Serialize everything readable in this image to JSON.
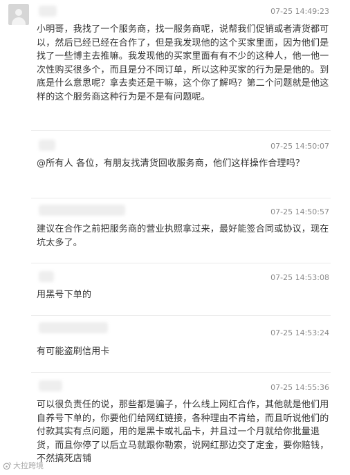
{
  "messages": [
    {
      "time": "07-25 14:49:23",
      "text": "小明哥，我找了一个服务商，找一服务商呢，说帮我们促销或者清货都可以，然后已经已经在合作了，但是我发现他的这个买家里面，因为他们是找了一些博主去推嘛。我发现他的买家里面有有不少的这种人，他一他一次性购买很多个，而且是分不同订单，所以这种买家的行为是是他的。到底是什么意思呢？拿去卖还是干嘛，这个你了解吗？第二个问题就是他这样的这个服务商这种行为是不是有问题呢。"
    },
    {
      "time": "07-25 14:50:07",
      "text": "@所有人 各位，有朋友找清货回收服务商，他们这样操作合理吗？"
    },
    {
      "time": "07-25 14:50:57",
      "text": "建议在合作之前把服务商的营业执照拿过来，最好能签合同或协议，现在坑太多了。"
    },
    {
      "time": "07-25 14:53:08",
      "text": "用黑号下单的"
    },
    {
      "time": "07-25 14:53:24",
      "text": "有可能盗刷信用卡"
    },
    {
      "time": "07-25 14:55:36",
      "text": "可以很负责任的说，那些都是骗子，什么线上网红合作，其他就是他们用自养号下单的，你要他们给网红链接，各种理由不肯给，而且听说他们的付款其实有点问题，用的是黑卡或礼品卡，并且过一个月就给你批量退货，而且你停了以后立马就跟你勒索，说网红那边交了定金，要你赔钱，不然搞死店铺"
    }
  ],
  "watermark": {
    "text": "大拉跨境"
  }
}
